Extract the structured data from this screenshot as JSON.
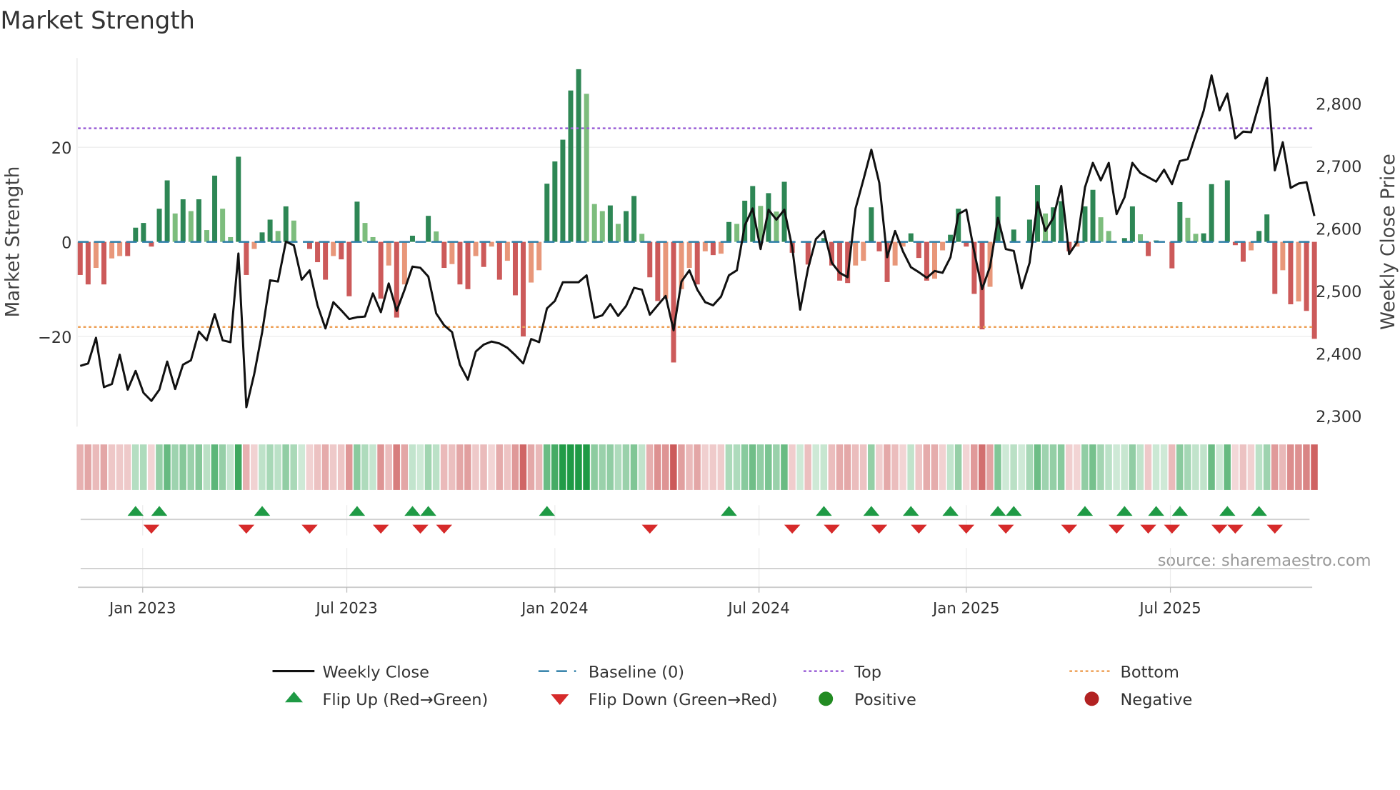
{
  "chart_data": {
    "type": "bar",
    "title": "Market Strength",
    "ylabel": "Market Strength",
    "y2label": "Weekly Close Price",
    "ylim": [
      -39,
      39
    ],
    "y2lim": [
      2285,
      2875
    ],
    "yticks": [
      {
        "v": 20,
        "label": "20"
      },
      {
        "v": 0,
        "label": "0"
      },
      {
        "v": -20,
        "label": "−20"
      }
    ],
    "y2ticks": [
      {
        "v": 2800,
        "label": "2,800"
      },
      {
        "v": 2700,
        "label": "2,700"
      },
      {
        "v": 2600,
        "label": "2,600"
      },
      {
        "v": 2500,
        "label": "2,500"
      },
      {
        "v": 2400,
        "label": "2,400"
      },
      {
        "v": 2300,
        "label": "2,300"
      }
    ],
    "xticks": [
      {
        "v": 7.9,
        "label": "Jan 2023"
      },
      {
        "v": 33.7,
        "label": "Jul 2023"
      },
      {
        "v": 60.0,
        "label": "Jan 2024"
      },
      {
        "v": 85.8,
        "label": "Jul 2024"
      },
      {
        "v": 112.0,
        "label": "Jan 2025"
      },
      {
        "v": 137.8,
        "label": "Jul 2025"
      }
    ],
    "top_level": 24,
    "bottom_level": -18,
    "strength": [
      -7,
      -9,
      -5.5,
      -9,
      -3.5,
      -3,
      -3,
      3,
      4,
      -1,
      7,
      13,
      6,
      9,
      6.5,
      9,
      2.5,
      14,
      7,
      1,
      18,
      -7,
      -1.5,
      2,
      4.7,
      2.3,
      7.5,
      4.5,
      0,
      -1.5,
      -4.3,
      -8,
      -3,
      -3.7,
      -11.5,
      8.5,
      4,
      1,
      -12,
      -5,
      -16,
      -9,
      1.3,
      0,
      5.5,
      2.2,
      -5.5,
      -4.7,
      -9,
      -10,
      -3,
      -5.3,
      -1,
      -8,
      -4,
      -11.3,
      -20,
      -8.6,
      -6,
      12.3,
      17,
      21.6,
      32,
      36.5,
      31.3,
      8,
      6.5,
      7.7,
      3.8,
      6.5,
      9.7,
      1.7,
      -7.5,
      -12.5,
      -12,
      -25.5,
      -10,
      -5.5,
      -9,
      -2,
      -2.8,
      -2.5,
      4.2,
      3.8,
      8.7,
      11.8,
      7.6,
      10.3,
      6.4,
      12.7,
      -2.3,
      0,
      -4.8,
      0,
      0.8,
      -5,
      -8.2,
      -8.7,
      -5,
      -4,
      7.3,
      -2,
      -8.5,
      -5,
      -1,
      1.8,
      -3.4,
      -8.2,
      -7.8,
      -1.8,
      1.5,
      7,
      -1,
      -11,
      -18.5,
      -9.5,
      9.6,
      0,
      2.6,
      0,
      4.7,
      12,
      6,
      7.3,
      8.6,
      -2,
      -1,
      7.5,
      11,
      5.2,
      2.3,
      0,
      0.8,
      7.5,
      1.6,
      -3,
      0.3,
      0,
      -5.6,
      8.4,
      5.1,
      1.7,
      1.8,
      12.2,
      0,
      13,
      -0.7,
      -4.2,
      -1.8,
      2.3,
      5.8,
      -11,
      -6,
      -13.2,
      -12.6,
      -14.6,
      -20.5
    ],
    "weekly_close": [
      2380,
      2384,
      2425,
      2346,
      2351,
      2398,
      2342,
      2372,
      2337,
      2324,
      2342,
      2387,
      2343,
      2382,
      2389,
      2435,
      2421,
      2463,
      2421,
      2418,
      2560,
      2314,
      2367,
      2434,
      2517,
      2515,
      2579,
      2573,
      2518,
      2533,
      2477,
      2440,
      2482,
      2469,
      2455,
      2458,
      2459,
      2496,
      2466,
      2512,
      2468,
      2502,
      2539,
      2537,
      2523,
      2464,
      2445,
      2434,
      2382,
      2358,
      2403,
      2414,
      2419,
      2416,
      2409,
      2397,
      2384,
      2423,
      2418,
      2472,
      2484,
      2514,
      2514,
      2514,
      2525,
      2457,
      2461,
      2479,
      2460,
      2476,
      2505,
      2502,
      2462,
      2477,
      2492,
      2437,
      2515,
      2533,
      2502,
      2482,
      2477,
      2491,
      2525,
      2533,
      2605,
      2632,
      2567,
      2630,
      2614,
      2630,
      2569,
      2470,
      2536,
      2583,
      2596,
      2545,
      2529,
      2522,
      2632,
      2678,
      2726,
      2673,
      2554,
      2596,
      2563,
      2538,
      2530,
      2521,
      2532,
      2529,
      2554,
      2623,
      2630,
      2563,
      2503,
      2539,
      2617,
      2567,
      2564,
      2504,
      2545,
      2642,
      2596,
      2617,
      2668,
      2559,
      2578,
      2666,
      2705,
      2677,
      2705,
      2623,
      2650,
      2705,
      2689,
      2682,
      2675,
      2694,
      2671,
      2708,
      2711,
      2750,
      2788,
      2845,
      2789,
      2816,
      2744,
      2755,
      2754,
      2799,
      2841,
      2693,
      2738,
      2665,
      2672,
      2674,
      2620
    ],
    "flip_up": [
      7,
      10,
      23,
      35,
      42,
      44,
      59,
      82,
      94,
      100,
      105,
      110,
      116,
      118,
      127,
      132,
      136,
      139,
      145,
      149
    ],
    "flip_down": [
      9,
      21,
      29,
      38,
      43,
      46,
      72,
      90,
      95,
      101,
      106,
      112,
      117,
      125,
      131,
      135,
      138,
      144,
      146,
      151
    ],
    "legend": [
      {
        "label": "Weekly Close",
        "kind": "line"
      },
      {
        "label": "Baseline (0)",
        "kind": "dash"
      },
      {
        "label": "Top",
        "kind": "dot-top"
      },
      {
        "label": "Bottom",
        "kind": "dot-bottom"
      },
      {
        "label": "Flip Up (Red→Green)",
        "kind": "tri-up"
      },
      {
        "label": "Flip Down (Green→Red)",
        "kind": "tri-down"
      },
      {
        "label": "Positive",
        "kind": "circle-pos"
      },
      {
        "label": "Negative",
        "kind": "circle-neg"
      }
    ],
    "legend_position": "bottom",
    "source": "source: sharemaestro.com"
  },
  "colors": {
    "pos_dark": "#2e8755",
    "pos_light": "#7dbd7d",
    "neg_dark": "#cc5a5a",
    "neg_light": "#e8977a",
    "close": "#111111",
    "baseline": "#2f7fa8",
    "top": "#9a5fd6",
    "bottom": "#eea158",
    "flip_up": "#1f9a45",
    "flip_down": "#d62a2a",
    "positive": "#228b22",
    "negative": "#b22222"
  }
}
